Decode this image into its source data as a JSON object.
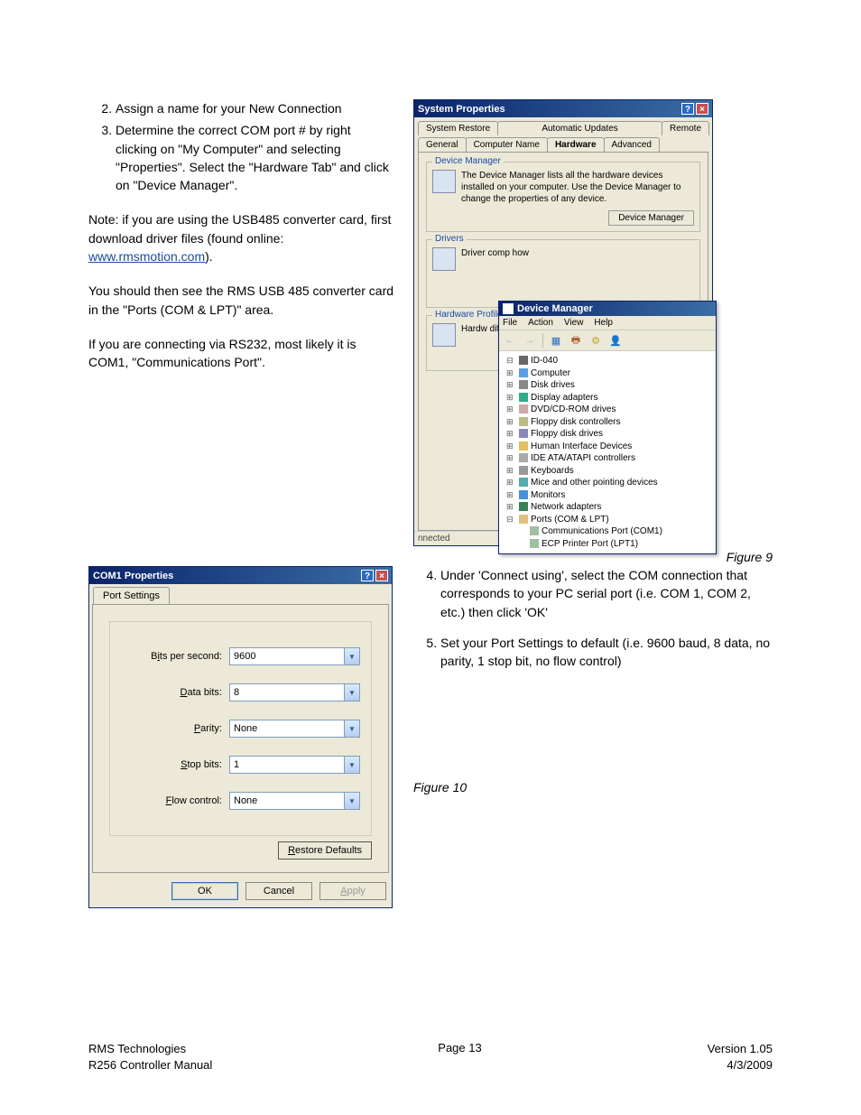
{
  "instructions_top": [
    {
      "num": 2,
      "text": "Assign a name for your New Connection"
    },
    {
      "num": 3,
      "text": "Determine the correct COM port # by right clicking on \"My Computer\" and selecting \"Properties\".  Select the \"Hardware Tab\" and click on \"Device Manager\"."
    }
  ],
  "note": {
    "prefix": "Note: if you are using the USB485 converter card, first download driver files (found online: ",
    "link_text": "www.rmsmotion.com",
    "suffix": ")."
  },
  "para2": "You should then see the RMS USB 485 converter card in the \"Ports (COM & LPT)\" area.",
  "para3": "If you are connecting via RS232, most likely it is COM1, \"Communications Port\".",
  "sysprops": {
    "title": "System Properties",
    "tabs_row1": [
      "System Restore",
      "Automatic Updates",
      "Remote"
    ],
    "tabs_row2": [
      "General",
      "Computer Name",
      "Hardware",
      "Advanced"
    ],
    "selected_tab": "Hardware",
    "dm_group": {
      "title": "Device Manager",
      "text": "The Device Manager lists all the hardware devices installed on your computer. Use the Device Manager to change the properties of any device.",
      "button": "Device Manager"
    },
    "drivers_group": {
      "title": "Drivers",
      "text": "Driver\ncomp\nhow"
    },
    "hw_group": {
      "title": "Hardware Profile",
      "text": "Hardw\ndiffere"
    }
  },
  "device_manager": {
    "title": "Device Manager",
    "menus": [
      "File",
      "Action",
      "View",
      "Help"
    ],
    "root": "ID-040",
    "items": [
      "Computer",
      "Disk drives",
      "Display adapters",
      "DVD/CD-ROM drives",
      "Floppy disk controllers",
      "Floppy disk drives",
      "Human Interface Devices",
      "IDE ATA/ATAPI controllers",
      "Keyboards",
      "Mice and other pointing devices",
      "Monitors",
      "Network adapters"
    ],
    "ports_label": "Ports (COM & LPT)",
    "ports_children": [
      "Communications Port (COM1)",
      "ECP Printer Port (LPT1)"
    ],
    "status": "nnected"
  },
  "figure9": "Figure 9",
  "instructions_bottom": [
    {
      "num": 4,
      "text": "Under 'Connect using', select the COM connection that corresponds to your PC serial port (i.e. COM 1, COM 2, etc.) then click 'OK'"
    },
    {
      "num": 5,
      "text": "Set your Port Settings to default (i.e. 9600 baud, 8 data, no parity, 1 stop bit, no flow control)"
    }
  ],
  "com1": {
    "title": "COM1 Properties",
    "tab": "Port Settings",
    "fields": {
      "bits_per_second": {
        "label_pre": "B",
        "label_u": "i",
        "label_post": "ts per second:",
        "value": "9600"
      },
      "data_bits": {
        "label_pre": "",
        "label_u": "D",
        "label_post": "ata bits:",
        "value": "8"
      },
      "parity": {
        "label_pre": "",
        "label_u": "P",
        "label_post": "arity:",
        "value": "None"
      },
      "stop_bits": {
        "label_pre": "",
        "label_u": "S",
        "label_post": "top bits:",
        "value": "1"
      },
      "flow_control": {
        "label_pre": "",
        "label_u": "F",
        "label_post": "low control:",
        "value": "None"
      }
    },
    "restore": "Restore Defaults",
    "restore_u": "R",
    "ok": "OK",
    "cancel": "Cancel",
    "apply": "Apply",
    "apply_u": "A"
  },
  "figure10": "Figure 10",
  "footer": {
    "left1": "RMS Technologies",
    "left2": "R256 Controller Manual",
    "center": "Page 13",
    "right1": "Version 1.05",
    "right2": "4/3/2009"
  }
}
